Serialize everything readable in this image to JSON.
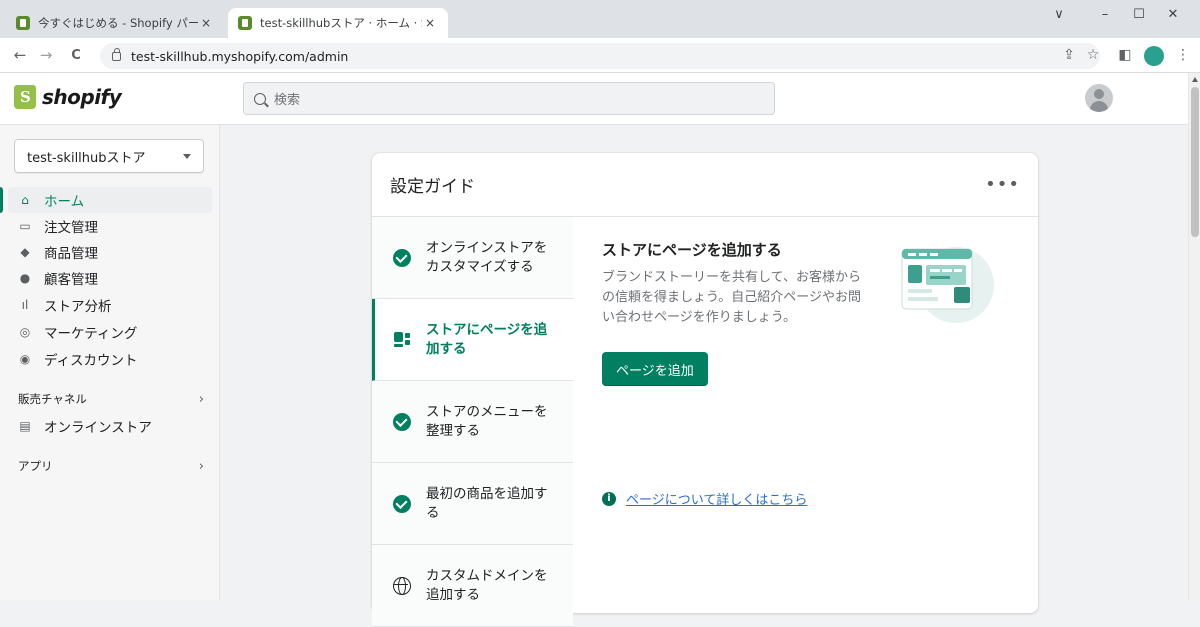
{
  "browser": {
    "tabs": [
      {
        "title": "今すぐはじめる - Shopify パートナー",
        "active": false
      },
      {
        "title": "test-skillhubストア · ホーム · Shopify",
        "active": true
      }
    ],
    "close_glyph": "×",
    "url": "test-skillhub.myshopify.com/admin",
    "window_controls": {
      "dropdown": "∨",
      "minimize": "–",
      "maximize": "☐",
      "close": "✕"
    },
    "nav": {
      "back": "←",
      "forward": "→",
      "reload": "C"
    },
    "toolbar_icons": {
      "share": "⇪",
      "bookmark": "☆",
      "sidepanel": "◧",
      "menu": "⋮"
    }
  },
  "header": {
    "logo_text": "shopify",
    "search_placeholder": "検索"
  },
  "sidebar": {
    "store_name": "test-skillhubストア",
    "items": [
      {
        "label": "ホーム",
        "icon": "home-icon",
        "glyph": "⌂",
        "active": true
      },
      {
        "label": "注文管理",
        "icon": "orders-icon",
        "glyph": "▭",
        "active": false
      },
      {
        "label": "商品管理",
        "icon": "tag-icon",
        "glyph": "◆",
        "active": false
      },
      {
        "label": "顧客管理",
        "icon": "customer-icon",
        "glyph": "●",
        "active": false
      },
      {
        "label": "ストア分析",
        "icon": "analytics-icon",
        "glyph": "ıl",
        "active": false
      },
      {
        "label": "マーケティング",
        "icon": "marketing-icon",
        "glyph": "◎",
        "active": false
      },
      {
        "label": "ディスカウント",
        "icon": "discount-icon",
        "glyph": "◉",
        "active": false
      }
    ],
    "sales_channels_label": "販売チャネル",
    "online_store_label": "オンラインストア",
    "online_store_glyph": "▤",
    "apps_label": "アプリ",
    "chevron": "›"
  },
  "guide": {
    "title": "設定ガイド",
    "more": "•••",
    "steps": [
      {
        "label": "オンラインストアを\nカスタマイズする",
        "state": "done"
      },
      {
        "label": "ストアにページを追\n加する",
        "state": "active"
      },
      {
        "label": "ストアのメニューを\n整理する",
        "state": "done"
      },
      {
        "label": "最初の商品を追加す\nる",
        "state": "done"
      },
      {
        "label": "カスタムドメインを\n追加する",
        "state": "todo"
      }
    ],
    "detail": {
      "heading": "ストアにページを追加する",
      "body": "ブランドストーリーを共有して、お客様からの信頼を得ましょう。自己紹介ページやお問い合わせページを作りましょう。",
      "button": "ページを追加",
      "learn_more": "ページについて詳しくはこちら",
      "info_glyph": "i"
    }
  },
  "colors": {
    "accent": "#008060",
    "link": "#2c6ecb",
    "brand_green": "#95bf47"
  }
}
